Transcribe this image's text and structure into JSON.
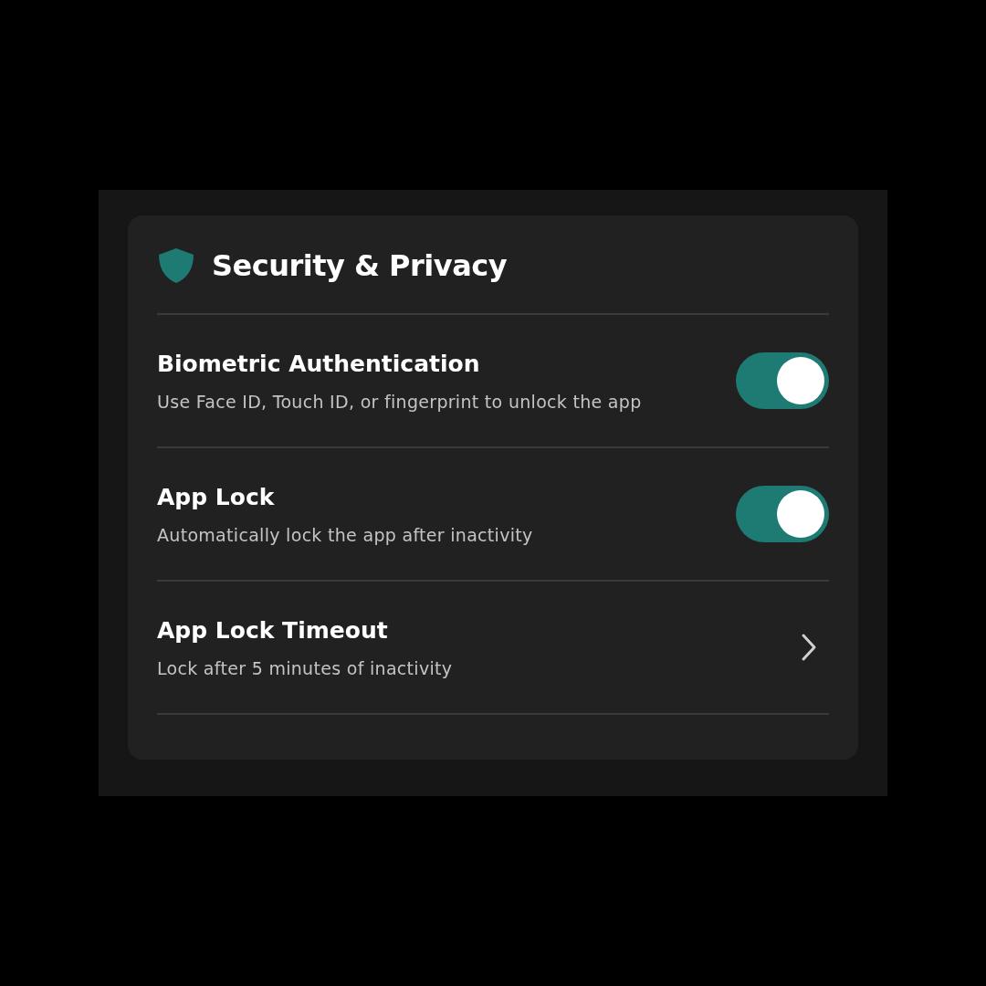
{
  "section": {
    "title": "Security & Privacy"
  },
  "settings": [
    {
      "kind": "toggle",
      "title": "Biometric Authentication",
      "description": "Use Face ID, Touch ID, or fingerprint to unlock the app",
      "on": true
    },
    {
      "kind": "toggle",
      "title": "App Lock",
      "description": "Automatically lock the app after inactivity",
      "on": true
    },
    {
      "kind": "link",
      "title": "App Lock Timeout",
      "description": "Lock after 5 minutes of inactivity"
    }
  ]
}
